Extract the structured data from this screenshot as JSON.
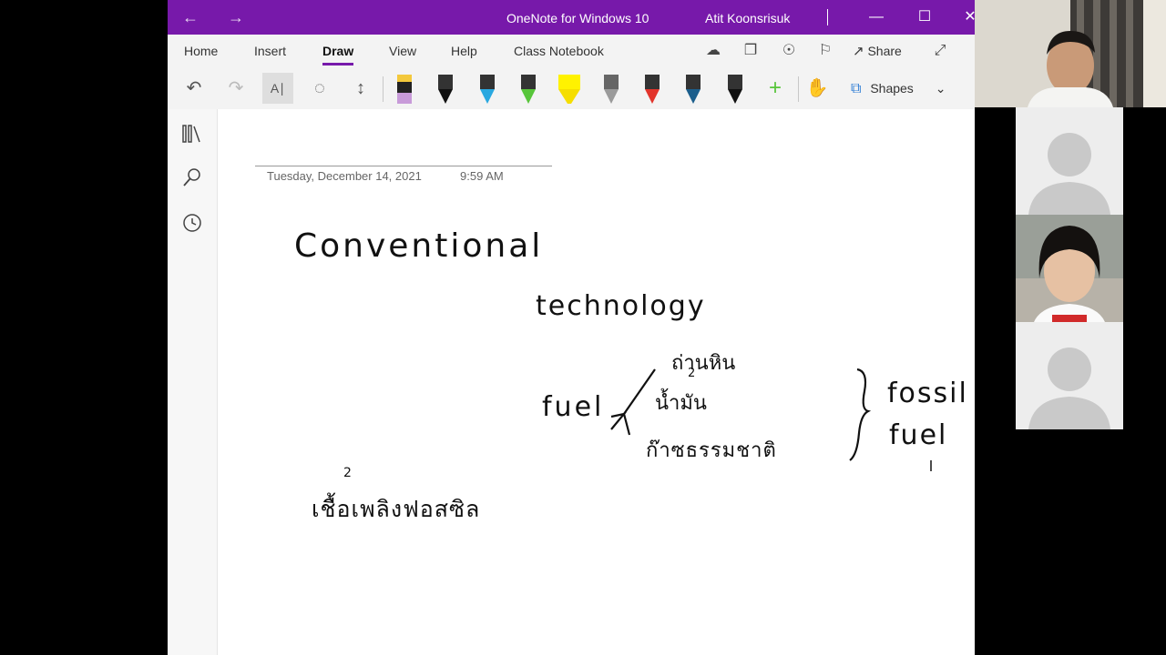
{
  "titlebar": {
    "app_title": "OneNote for Windows 10",
    "user_name": "Atit  Koonsrisuk",
    "back_icon": "back-arrow-icon",
    "forward_icon": "forward-arrow-icon"
  },
  "tabs": [
    {
      "label": "Home"
    },
    {
      "label": "Insert"
    },
    {
      "label": "Draw",
      "active": true
    },
    {
      "label": "View"
    },
    {
      "label": "Help"
    },
    {
      "label": "Class Notebook"
    }
  ],
  "ribbon_right": {
    "share_label": "Share"
  },
  "toolbar": {
    "shapes_label": "Shapes",
    "pens": [
      {
        "color": "#c89bd9",
        "type": "highlighter"
      },
      {
        "color": "#111111",
        "type": "pen"
      },
      {
        "color": "#29a8e0",
        "type": "pen"
      },
      {
        "color": "#57c53a",
        "type": "pen"
      },
      {
        "color": "#fff200",
        "type": "highlighter"
      },
      {
        "color": "#9a9a9a",
        "type": "pencil"
      },
      {
        "color": "#e2342b",
        "type": "pen"
      },
      {
        "color": "#1b5e8c",
        "type": "pen"
      },
      {
        "color": "#111111",
        "type": "pen"
      }
    ]
  },
  "page": {
    "date": "Tuesday, December 14, 2021",
    "time": "9:59 AM"
  },
  "ink": {
    "conventional": "Conventional",
    "technology": "technology",
    "fuel_left": "fuel",
    "coal_thai": "ถ่านหิน",
    "oil_thai": "น้ำมัน",
    "gas_thai": "ก๊าซธรรมชาติ",
    "fossil": "fossil",
    "fuel_right": "fuel",
    "fossil_fuel_thai": "เชื้อเพลิงฟอสซิล",
    "superscript_2": "2"
  },
  "colors": {
    "brand": "#7719aa",
    "ribbon_bg": "#f3f3f3"
  }
}
